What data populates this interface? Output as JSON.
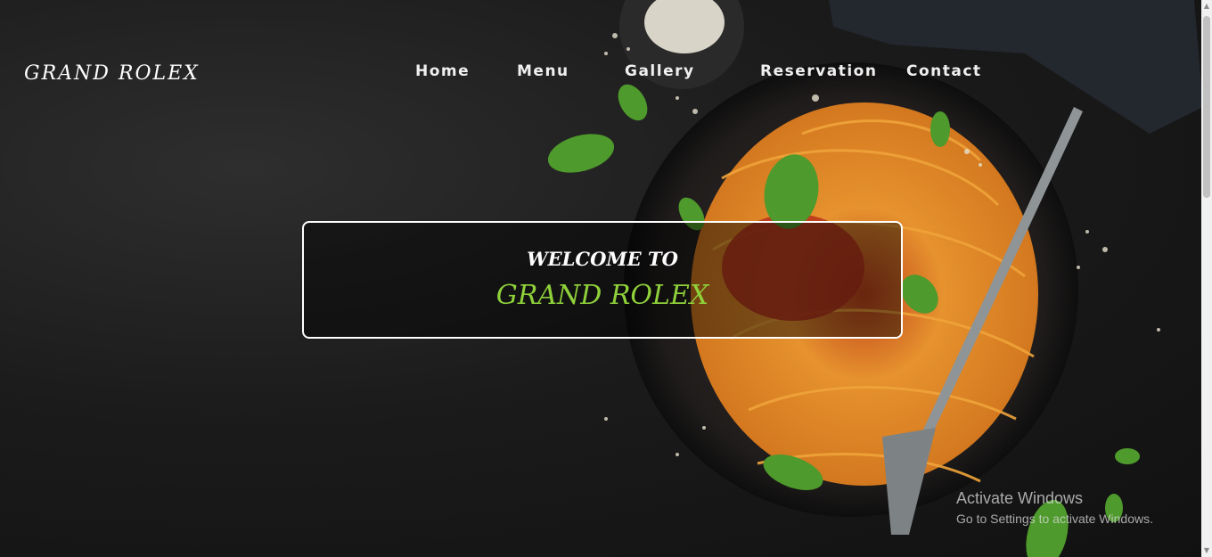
{
  "brand": {
    "name": "GRAND ROLEX"
  },
  "nav": {
    "items": [
      {
        "label": "Home"
      },
      {
        "label": "Menu"
      },
      {
        "label": "Gallery"
      },
      {
        "label": "Reservation"
      },
      {
        "label": "Contact"
      }
    ]
  },
  "hero": {
    "welcome": "WELCOME TO",
    "title": "GRAND ROLEX"
  },
  "watermark": {
    "line1": "Activate Windows",
    "line2": "Go to Settings to activate Windows."
  },
  "colors": {
    "accent": "#8fd13a",
    "text": "#ffffff",
    "background": "#1b1b1b"
  }
}
